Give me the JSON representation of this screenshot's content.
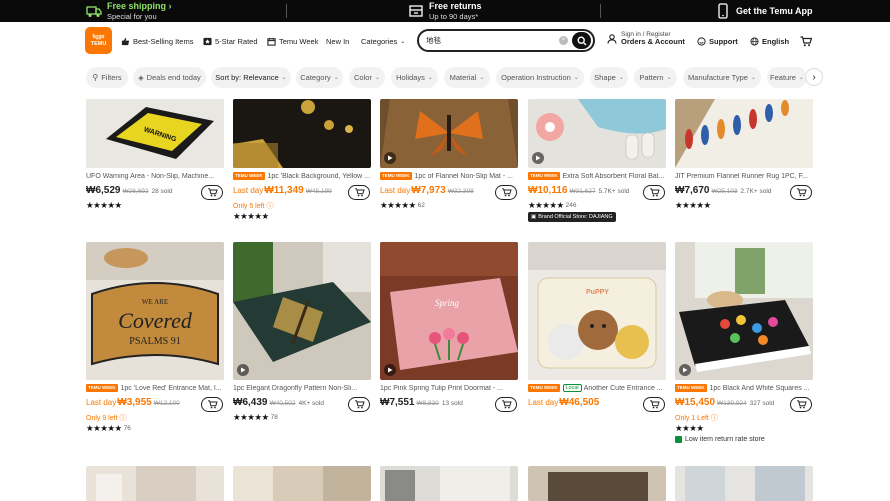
{
  "promo": {
    "shipping_title": "Free shipping",
    "shipping_sub": "Special for you",
    "returns_title": "Free returns",
    "returns_sub": "Up to 90 days*",
    "app": "Get the Temu App"
  },
  "header": {
    "logo_line1": "ხცვი",
    "logo_line2": "TEMU",
    "nav": [
      "Best-Selling Items",
      "5-Star Rated",
      "Temu Week",
      "New In",
      "Categories"
    ],
    "search_value": "地毯",
    "account_small": "Sign in / Register",
    "account_big": "Orders & Account",
    "support": "Support",
    "language": "English"
  },
  "filters": [
    "Filters",
    "Deals end today",
    "Sort by: Relevance",
    "Category",
    "Color",
    "Holidays",
    "Material",
    "Operation Instruction",
    "Shape",
    "Pattern",
    "Manufacture Type",
    "Feature"
  ],
  "products_row1": [
    {
      "badge": "",
      "title": "UFO Warning Area - Non-Slip, Machine...",
      "lastday": "",
      "price": "₩6,529",
      "old": "₩26,692",
      "sold": "28 sold",
      "note": "",
      "stars": "★★★★★",
      "rcount": "",
      "extra": ""
    },
    {
      "badge": "TEMU WEEK",
      "title": "1pc 'Black Background, Yellow ...",
      "lastday": "Last day",
      "price": "₩11,349",
      "old": "₩45,199",
      "sold": "",
      "note": "Only 5 left ⓘ",
      "stars": "★★★★★",
      "rcount": "",
      "extra": ""
    },
    {
      "badge": "TEMU WEEK",
      "title": "1pc of Flannel Non-Slip Mat - ...",
      "lastday": "Last day",
      "price": "₩7,973",
      "old": "₩32,398",
      "sold": "",
      "note": "",
      "stars": "★★★★★",
      "rcount": "62",
      "extra": ""
    },
    {
      "badge": "TEMU WEEK",
      "title": "Extra Soft Absorbent Floral Bat...",
      "lastday": "",
      "price": "₩10,116",
      "old": "₩31,627",
      "sold": "5.7K+ sold",
      "note": "",
      "stars": "★★★★★",
      "rcount": "246",
      "extra": "Brand Official Store: DAJIANG"
    },
    {
      "badge": "",
      "title": "JIT Premium Flannel Runner Rug 1PC, F...",
      "lastday": "",
      "price": "₩7,670",
      "old": "₩25,103",
      "sold": "2.7K+ sold",
      "note": "",
      "stars": "★★★★★",
      "rcount": "",
      "extra": ""
    }
  ],
  "products_row2": [
    {
      "badge": "TEMU WEEK",
      "title": "1pc 'Love Red' Entrance Mat, I...",
      "lastday": "Last day",
      "price": "₩3,955",
      "old": "₩12,100",
      "sold": "",
      "note": "Only 9 left ⓘ",
      "stars": "★★★★★",
      "rcount": "76",
      "extra": ""
    },
    {
      "badge": "",
      "title": "1pc Elegant Dragonfly Pattern Non-Sli...",
      "lastday": "",
      "price": "₩6,439",
      "old": "₩40,502",
      "sold": "4K+ sold",
      "note": "",
      "stars": "★★★★★",
      "rcount": "78",
      "extra": ""
    },
    {
      "badge": "",
      "title": "1pc Pink Spring Tulip Print Doormat - ...",
      "lastday": "",
      "price": "₩7,551",
      "old": "₩8,830",
      "sold": "13 sold",
      "note": "",
      "stars": "",
      "rcount": "",
      "extra": ""
    },
    {
      "badge": "TEMU WEEK",
      "title": "Another Cute Entrance ...",
      "local": "Local",
      "lastday": "Last day",
      "price": "₩46,505",
      "old": "",
      "sold": "",
      "note": "",
      "stars": "",
      "rcount": "",
      "extra": ""
    },
    {
      "badge": "TEMU WEEK",
      "title": "1pc Black And White Squares ...",
      "lastday": "",
      "price": "₩15,450",
      "old": "₩139,924",
      "sold": "327 sold",
      "note": "Only 1 Left ⓘ",
      "stars": "★★★★",
      "rcount": "",
      "extra": "Low item return rate store"
    }
  ],
  "colors": {
    "accent": "#fb7701",
    "promo_bg": "#0a0a0a",
    "promo_green": "#8fe36a"
  }
}
